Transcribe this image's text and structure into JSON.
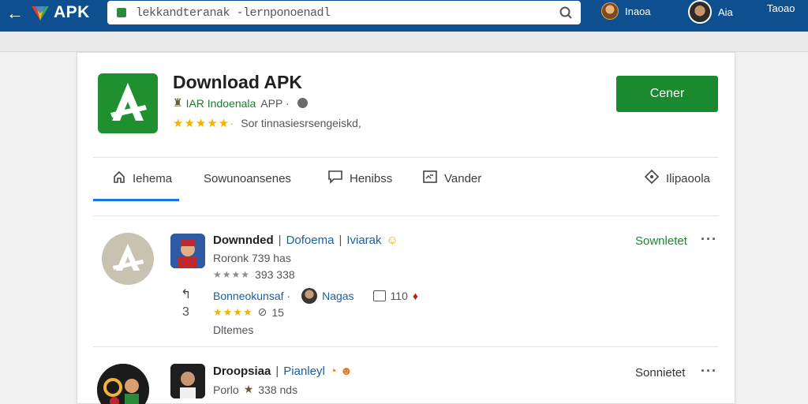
{
  "topbar": {
    "brand": "APK",
    "url": "lekkandteranak -lernponoenadl",
    "users": [
      {
        "name": "Inaoa"
      },
      {
        "name": "Aia"
      },
      {
        "name": "Taoao"
      }
    ]
  },
  "app": {
    "title": "Download APK",
    "developer": "IAR Indoenala",
    "category": "APP ·",
    "stars": "★★★★★·",
    "tagline": "Sor tinnasiesrsengeiskd,",
    "primary_button": "Cener"
  },
  "tabs": [
    {
      "label": "Iehema",
      "icon": "home-icon"
    },
    {
      "label": "Sowunoansenes"
    },
    {
      "label": "Henibss",
      "icon": "chat-icon"
    },
    {
      "label": "Vander",
      "icon": "image-icon"
    },
    {
      "label": "Ilipaoola",
      "icon": "puzzle-icon"
    }
  ],
  "items": [
    {
      "title": "Downnded",
      "tag1": "Dofoema",
      "tag2": "Iviarak",
      "meta": "Roronk 739 has",
      "rating_stars": "★★★★",
      "rating_text": "393 338",
      "link": "Bonneokunsaf ·",
      "link_user": "Nagas",
      "count": "110",
      "yellow_stars": "★★★★",
      "comments": "15",
      "side_number": "3",
      "footer": "Dltemes",
      "status": "Sownletet"
    },
    {
      "title": "Droopsiaa",
      "tag1": "Pianleyl",
      "meta": "Porlo",
      "meta_star": "★",
      "meta2": "338 nds",
      "status": "Sonnietet"
    }
  ],
  "colors": {
    "topbar": "#0d4f8f",
    "primary": "#1b8a2f",
    "accent": "#1a73e8",
    "star": "#f2b300"
  }
}
